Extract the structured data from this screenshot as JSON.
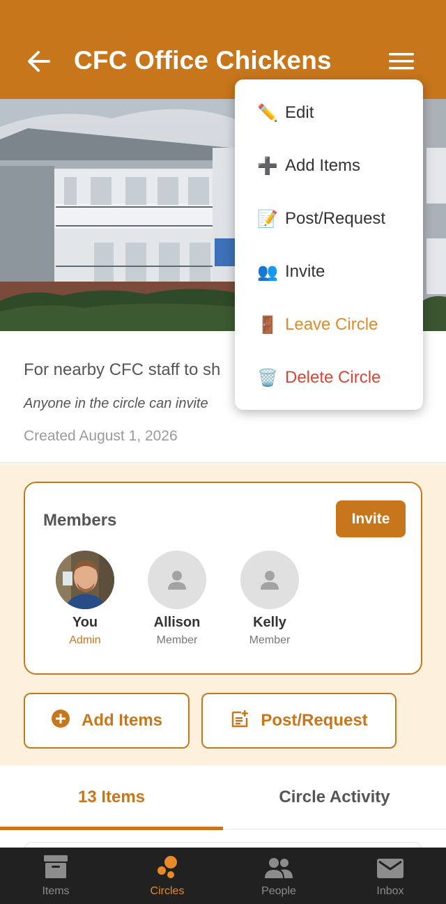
{
  "app_bar": {
    "title": "CFC Office Chickens"
  },
  "circle": {
    "description": "For nearby CFC staff to sh",
    "note": "Anyone in the circle can invite",
    "created": "Created August 1, 2026"
  },
  "members": {
    "title": "Members",
    "invite_label": "Invite",
    "list": [
      {
        "name": "You",
        "role": "Admin"
      },
      {
        "name": "Allison",
        "role": "Member"
      },
      {
        "name": "Kelly",
        "role": "Member"
      }
    ]
  },
  "actions": {
    "add_items": "Add Items",
    "post_request": "Post/Request"
  },
  "tabs": [
    {
      "label": "13 Items",
      "active": true
    },
    {
      "label": "Circle Activity",
      "active": false
    }
  ],
  "bottom_nav": [
    {
      "label": "Items",
      "icon": "archive-icon"
    },
    {
      "label": "Circles",
      "icon": "circles-icon",
      "active": true
    },
    {
      "label": "People",
      "icon": "people-icon"
    },
    {
      "label": "Inbox",
      "icon": "mail-icon"
    }
  ],
  "menu": {
    "items": [
      {
        "emoji": "✏️",
        "label": "Edit"
      },
      {
        "emoji": "➕",
        "label": "Add Items"
      },
      {
        "emoji": "📝",
        "label": "Post/Request"
      },
      {
        "emoji": "👥",
        "label": "Invite"
      },
      {
        "emoji": "🚪",
        "label": "Leave Circle"
      },
      {
        "emoji": "🗑️",
        "label": "Delete Circle"
      }
    ]
  },
  "colors": {
    "brand": "#c8761b",
    "cream": "#fdf1dd",
    "danger": "#d94535",
    "nav_bg": "#212121"
  }
}
